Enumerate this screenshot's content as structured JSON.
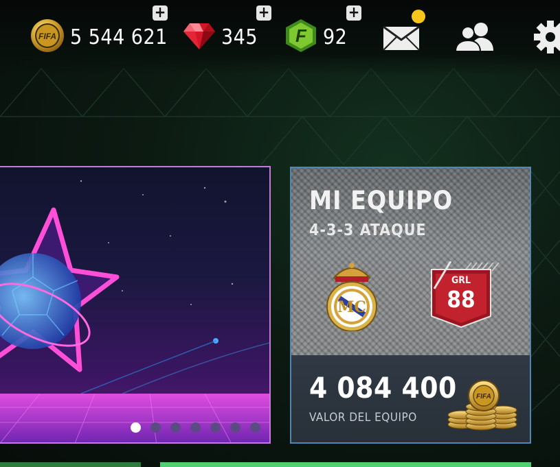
{
  "currencies": {
    "coins": {
      "icon": "fifa-coin-icon",
      "value": "5 544 621",
      "coin_text": "FIFA"
    },
    "gems": {
      "icon": "gem-icon",
      "value": "345"
    },
    "points": {
      "icon": "fifa-points-icon",
      "value": "92",
      "glyph": "F"
    }
  },
  "header_icons": [
    "mail-icon",
    "friends-icon",
    "settings-icon"
  ],
  "promo": {
    "carousel_dots": 7,
    "active_dot": 0
  },
  "team": {
    "title": "MI EQUIPO",
    "formation": "4-3-3 ATAQUE",
    "rating_label": "GRL",
    "rating": "88",
    "value": "4 084 400",
    "value_label": "VALOR DEL EQUIPO",
    "coin_text": "FIFA"
  },
  "colors": {
    "accent_green": "#4fcf72",
    "notification": "#f6c61b",
    "rating_red": "#b51a25",
    "panel_border": "#4f86b2",
    "promo_border": "#c37cd6"
  }
}
